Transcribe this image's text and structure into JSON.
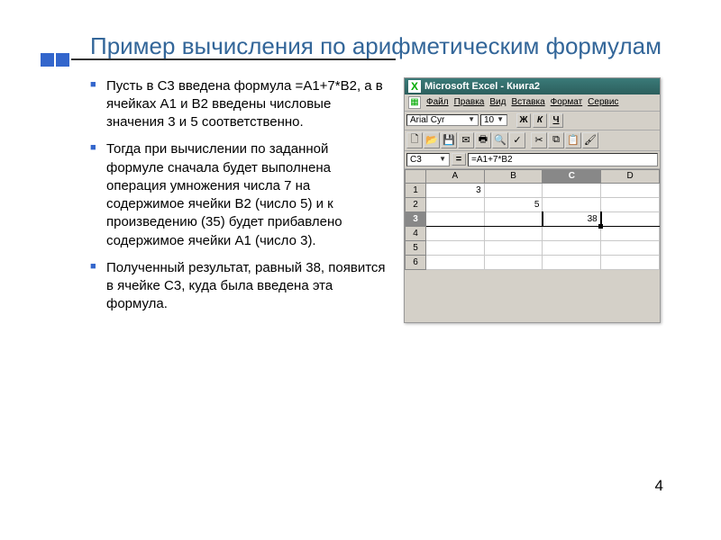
{
  "title": "Пример вычисления по арифметическим формулам",
  "bullets": [
    "Пусть в С3 введена формула =А1+7*В2, а в ячейках А1 и В2 введены числовые значения 3 и 5 соответственно.",
    "Тогда при вычислении по заданной формуле сначала будет выполнена операция умножения числа 7 на содержимое ячейки В2 (число 5) и к произведению (35) будет прибавлено содержимое ячейки А1 (число 3).",
    "Полученный результат, равный 38, появится в ячейке С3, куда была введена эта формула."
  ],
  "excel": {
    "app_title": "Microsoft Excel - Книга2",
    "menu": [
      "Файл",
      "Правка",
      "Вид",
      "Вставка",
      "Формат",
      "Сервис"
    ],
    "font": "Arial Cyr",
    "size": "10",
    "fmt_buttons": [
      "Ж",
      "К",
      "Ч"
    ],
    "name_box": "C3",
    "formula": "=A1+7*B2",
    "columns": [
      "A",
      "B",
      "C",
      "D"
    ],
    "rows": [
      "1",
      "2",
      "3",
      "4",
      "5",
      "6"
    ],
    "cells": {
      "A1": "3",
      "B2": "5",
      "C3": "38"
    },
    "selected_cell": "C3"
  },
  "page_number": "4",
  "chart_data": {
    "type": "table",
    "title": "Excel sheet sample",
    "columns": [
      "A",
      "B",
      "C",
      "D"
    ],
    "rows": [
      {
        "row": 1,
        "A": 3,
        "B": null,
        "C": null,
        "D": null
      },
      {
        "row": 2,
        "A": null,
        "B": 5,
        "C": null,
        "D": null
      },
      {
        "row": 3,
        "A": null,
        "B": null,
        "C": 38,
        "D": null
      },
      {
        "row": 4,
        "A": null,
        "B": null,
        "C": null,
        "D": null
      },
      {
        "row": 5,
        "A": null,
        "B": null,
        "C": null,
        "D": null
      },
      {
        "row": 6,
        "A": null,
        "B": null,
        "C": null,
        "D": null
      }
    ],
    "formula_cell": {
      "cell": "C3",
      "formula": "=A1+7*B2"
    }
  }
}
